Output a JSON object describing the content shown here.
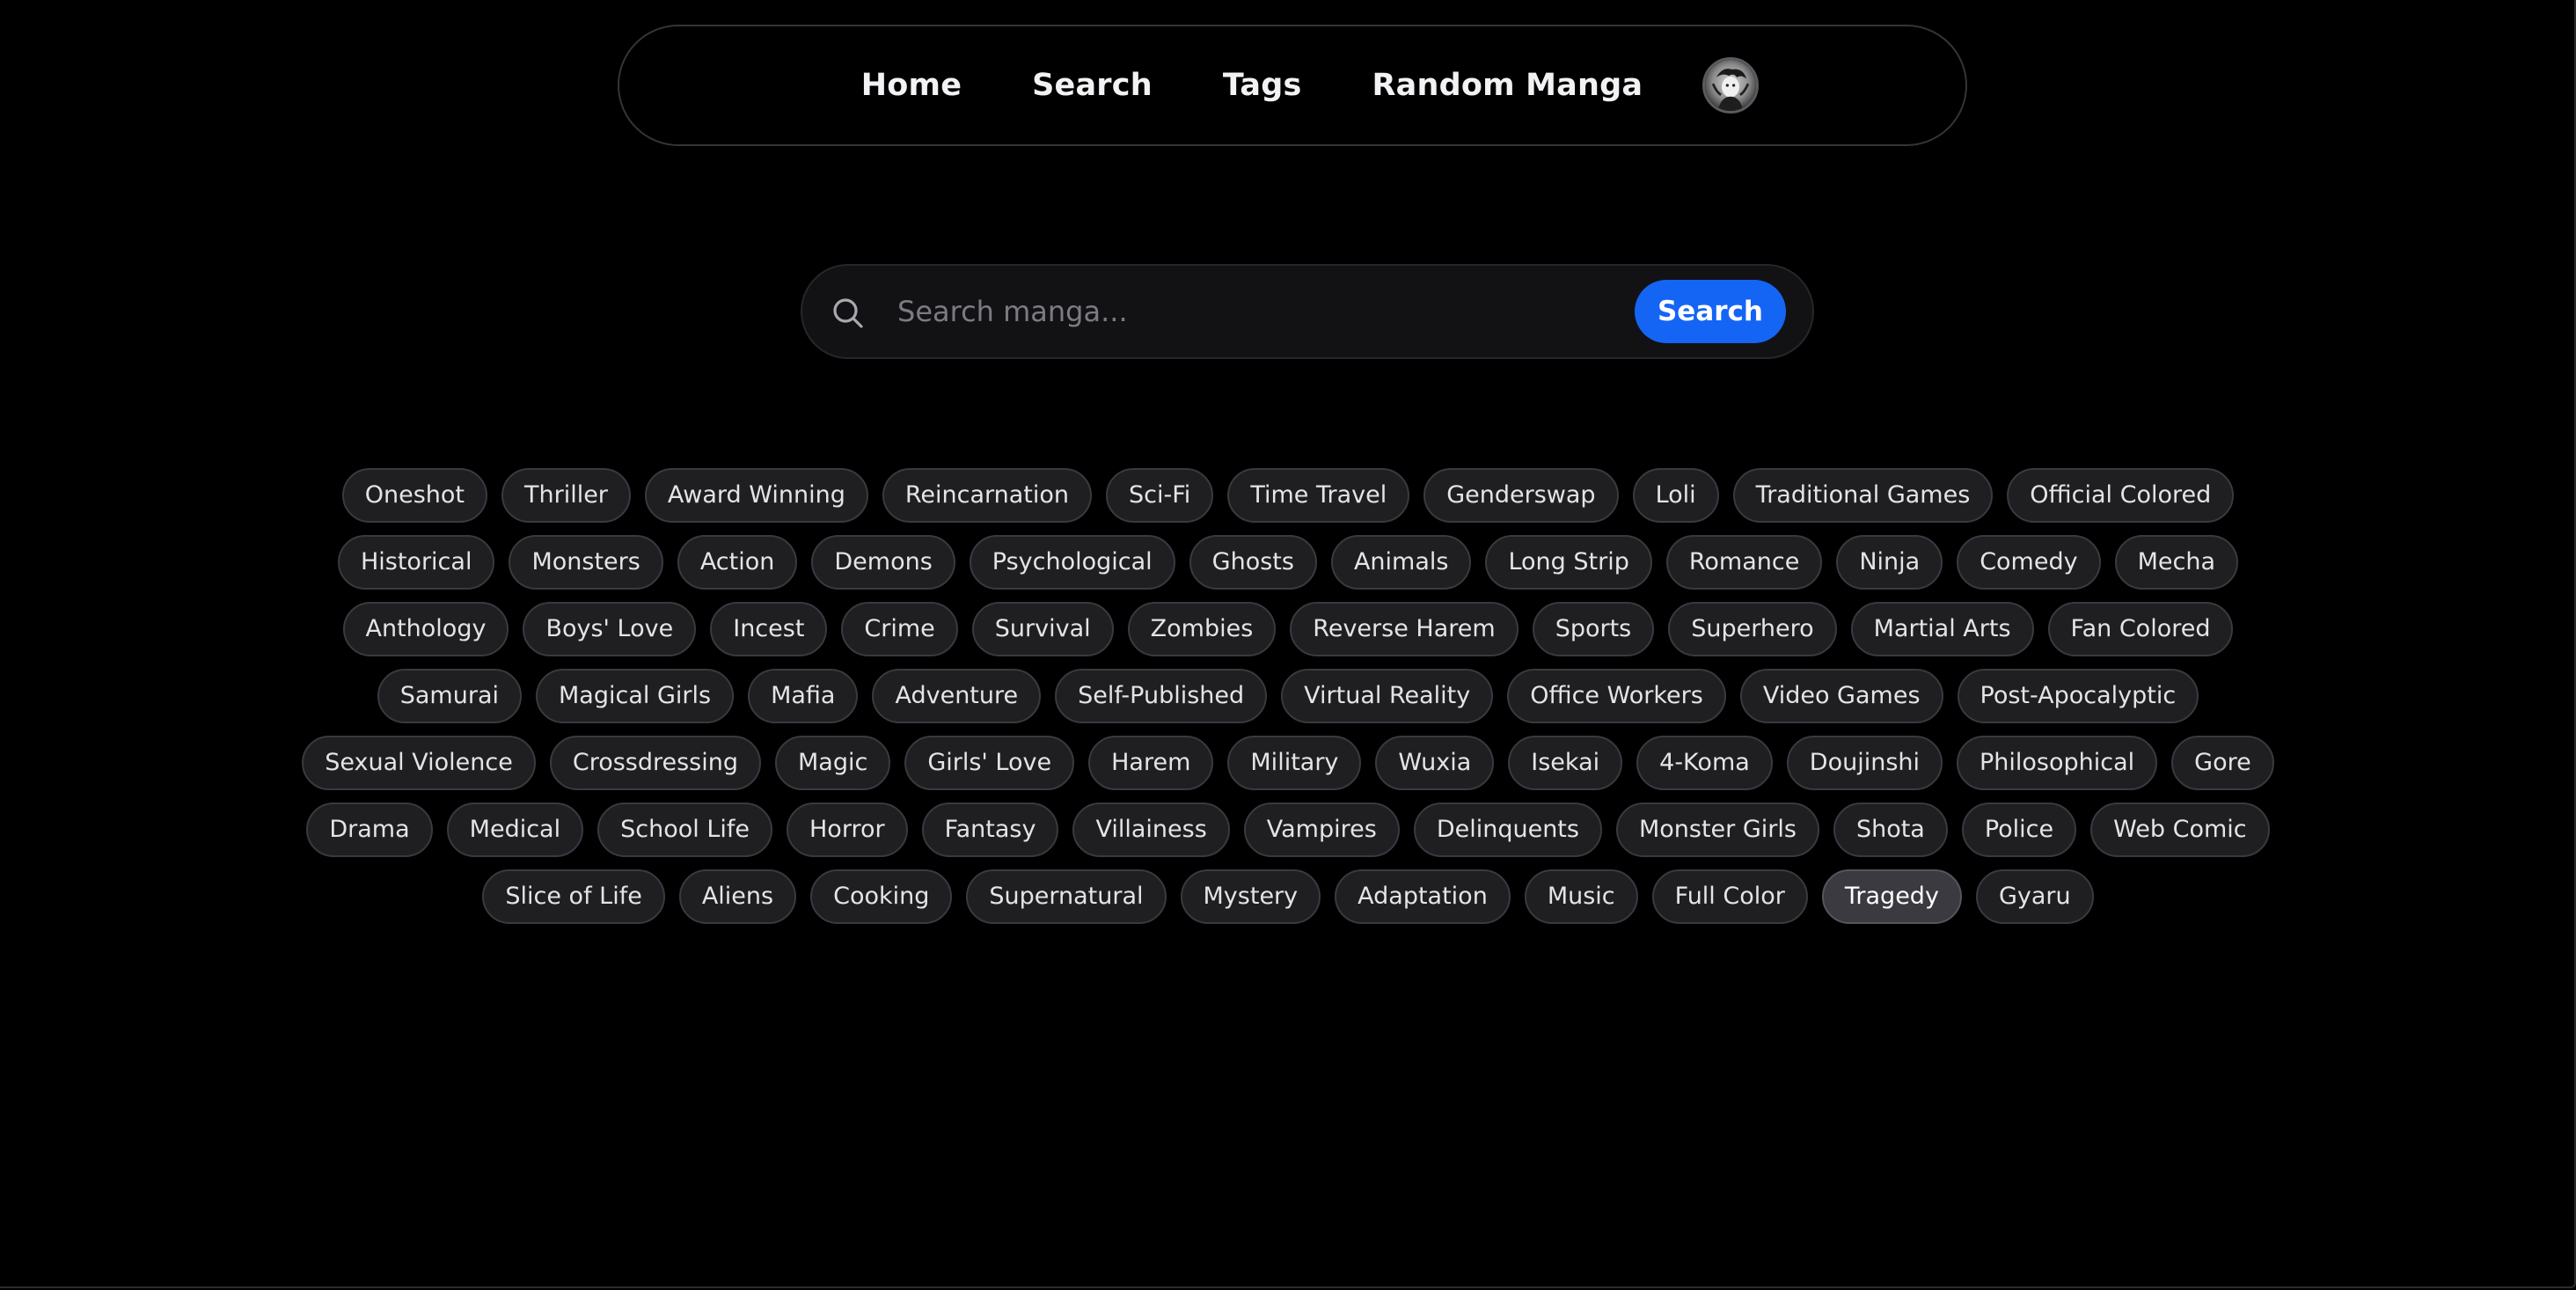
{
  "nav": {
    "links": [
      "Home",
      "Search",
      "Tags",
      "Random Manga"
    ],
    "avatar_icon": "user-avatar-icon"
  },
  "search": {
    "placeholder": "Search manga...",
    "button_label": "Search",
    "icon": "search-icon",
    "accent_color": "#1565f5"
  },
  "tags": {
    "items": [
      "Oneshot",
      "Thriller",
      "Award Winning",
      "Reincarnation",
      "Sci-Fi",
      "Time Travel",
      "Genderswap",
      "Loli",
      "Traditional Games",
      "Official Colored",
      "Historical",
      "Monsters",
      "Action",
      "Demons",
      "Psychological",
      "Ghosts",
      "Animals",
      "Long Strip",
      "Romance",
      "Ninja",
      "Comedy",
      "Mecha",
      "Anthology",
      "Boys' Love",
      "Incest",
      "Crime",
      "Survival",
      "Zombies",
      "Reverse Harem",
      "Sports",
      "Superhero",
      "Martial Arts",
      "Fan Colored",
      "Samurai",
      "Magical Girls",
      "Mafia",
      "Adventure",
      "Self-Published",
      "Virtual Reality",
      "Office Workers",
      "Video Games",
      "Post-Apocalyptic",
      "Sexual Violence",
      "Crossdressing",
      "Magic",
      "Girls' Love",
      "Harem",
      "Military",
      "Wuxia",
      "Isekai",
      "4-Koma",
      "Doujinshi",
      "Philosophical",
      "Gore",
      "Drama",
      "Medical",
      "School Life",
      "Horror",
      "Fantasy",
      "Villainess",
      "Vampires",
      "Delinquents",
      "Monster Girls",
      "Shota",
      "Police",
      "Web Comic",
      "Slice of Life",
      "Aliens",
      "Cooking",
      "Supernatural",
      "Mystery",
      "Adaptation",
      "Music",
      "Full Color",
      "Tragedy",
      "Gyaru"
    ],
    "active": "Tragedy"
  }
}
